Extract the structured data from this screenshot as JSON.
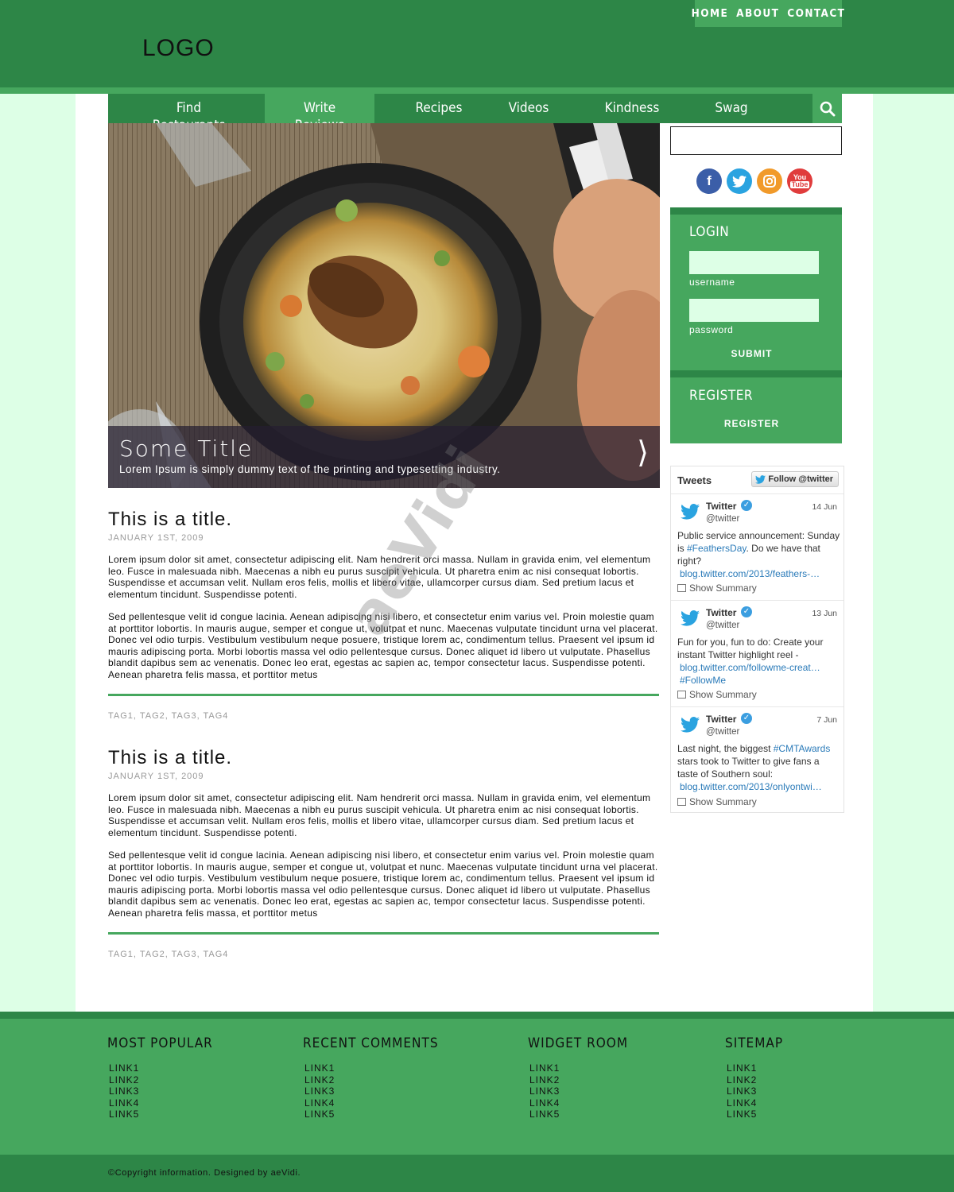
{
  "header": {
    "logo": "LOGO",
    "topnav": [
      "HOME",
      "ABOUT",
      "CONTACT"
    ]
  },
  "nav": {
    "tabs": [
      {
        "line1": "Find",
        "line2": "Restaurants"
      },
      {
        "line1": "Write",
        "line2": "Reviews"
      },
      {
        "line1": "Recipes",
        "line2": ""
      },
      {
        "line1": "Videos",
        "line2": ""
      },
      {
        "line1": "Kindness",
        "line2": ""
      },
      {
        "line1": "Swag",
        "line2": ""
      }
    ],
    "search_icon": "search-icon"
  },
  "hero": {
    "title": "Some Title",
    "text": "Lorem Ipsum is simply dummy text of the printing and typesetting industry.",
    "arrow": "⟩"
  },
  "posts": [
    {
      "title": "This is a title.",
      "date": "JANUARY 1ST, 2009",
      "para1": "Lorem ipsum dolor sit amet, consectetur adipiscing elit. Nam hendrerit orci massa. Nullam in gravida enim, vel elementum leo. Fusce in malesuada nibh. Maecenas a nibh eu purus suscipit vehicula. Ut pharetra enim ac nisi consequat lobortis. Suspendisse et accumsan velit. Nullam eros felis, mollis et libero vitae, ullamcorper cursus diam. Sed pretium lacus et elementum tincidunt. Suspendisse potenti.",
      "para2": "Sed pellentesque velit id congue lacinia. Aenean adipiscing nisi libero, et consectetur enim varius vel. Proin molestie quam at porttitor lobortis. In mauris augue, semper et congue ut, volutpat et nunc. Maecenas vulputate tincidunt urna vel placerat. Donec vel odio turpis. Vestibulum vestibulum neque posuere, tristique lorem ac, condimentum tellus. Praesent vel ipsum id mauris adipiscing porta. Morbi lobortis massa vel odio pellentesque cursus. Donec aliquet id libero ut vulputate. Phasellus blandit dapibus sem ac venenatis. Donec leo erat, egestas ac sapien ac, tempor consectetur lacus. Suspendisse potenti. Aenean pharetra felis massa, et porttitor metus",
      "tags": "TAG1, TAG2, TAG3, TAG4"
    },
    {
      "title": "This is a title.",
      "date": "JANUARY 1ST, 2009",
      "para1": "Lorem ipsum dolor sit amet, consectetur adipiscing elit. Nam hendrerit orci massa. Nullam in gravida enim, vel elementum leo. Fusce in malesuada nibh. Maecenas a nibh eu purus suscipit vehicula. Ut pharetra enim ac nisi consequat lobortis. Suspendisse et accumsan velit. Nullam eros felis, mollis et libero vitae, ullamcorper cursus diam. Sed pretium lacus et elementum tincidunt. Suspendisse potenti.",
      "para2": "Sed pellentesque velit id congue lacinia. Aenean adipiscing nisi libero, et consectetur enim varius vel. Proin molestie quam at porttitor lobortis. In mauris augue, semper et congue ut, volutpat et nunc. Maecenas vulputate tincidunt urna vel placerat. Donec vel odio turpis. Vestibulum vestibulum neque posuere, tristique lorem ac, condimentum tellus. Praesent vel ipsum id mauris adipiscing porta. Morbi lobortis massa vel odio pellentesque cursus. Donec aliquet id libero ut vulputate. Phasellus blandit dapibus sem ac venenatis. Donec leo erat, egestas ac sapien ac, tempor consectetur lacus. Suspendisse potenti. Aenean pharetra felis massa, et porttitor metus",
      "tags": "TAG1, TAG2, TAG3, TAG4"
    }
  ],
  "watermark": "aeVidi",
  "social": [
    "facebook-icon",
    "twitter-icon",
    "instagram-icon",
    "youtube-icon"
  ],
  "login": {
    "heading": "LOGIN",
    "username_label": "username",
    "password_label": "password",
    "submit": "SUBMIT"
  },
  "register": {
    "heading": "REGISTER",
    "button": "REGISTER"
  },
  "tweets": {
    "title": "Tweets",
    "follow": "Follow @twitter",
    "summary_label": "Show Summary",
    "items": [
      {
        "name": "Twitter",
        "handle": "@twitter",
        "date": "14 Jun",
        "text_before": "Public service announcement: Sunday is ",
        "hashtag1": "#FeathersDay",
        "text_after": ". Do we have that right?",
        "link": "blog.twitter.com/2013/feathers-…",
        "hashtag2": ""
      },
      {
        "name": "Twitter",
        "handle": "@twitter",
        "date": "13 Jun",
        "text_before": "Fun for you, fun to do: Create your instant Twitter highlight reel -",
        "hashtag1": "",
        "text_after": "",
        "link": "blog.twitter.com/followme-creat…",
        "hashtag2": "#FollowMe"
      },
      {
        "name": "Twitter",
        "handle": "@twitter",
        "date": "7 Jun",
        "text_before": "Last night, the biggest ",
        "hashtag1": "#CMTAwards",
        "text_after": " stars took to Twitter to give fans a taste of Southern soul:",
        "link": "blog.twitter.com/2013/onlyontwi…",
        "hashtag2": ""
      }
    ]
  },
  "footer": {
    "columns": [
      {
        "heading": "MOST POPULAR",
        "links": [
          "LINK1",
          "LINK2",
          "LINK3",
          "LINK4",
          "LINK5"
        ]
      },
      {
        "heading": "RECENT COMMENTS",
        "links": [
          "LINK1",
          "LINK2",
          "LINK3",
          "LINK4",
          "LINK5"
        ]
      },
      {
        "heading": "WIDGET ROOM",
        "links": [
          "LINK1",
          "LINK2",
          "LINK3",
          "LINK4",
          "LINK5"
        ]
      },
      {
        "heading": "SITEMAP",
        "links": [
          "LINK1",
          "LINK2",
          "LINK3",
          "LINK4",
          "LINK5"
        ]
      }
    ],
    "copyright": "©Copyright information. Designed by aeVidi."
  },
  "colors": {
    "dark_green": "#2d8647",
    "green": "#46a75e",
    "mint": "#ddffe6"
  }
}
